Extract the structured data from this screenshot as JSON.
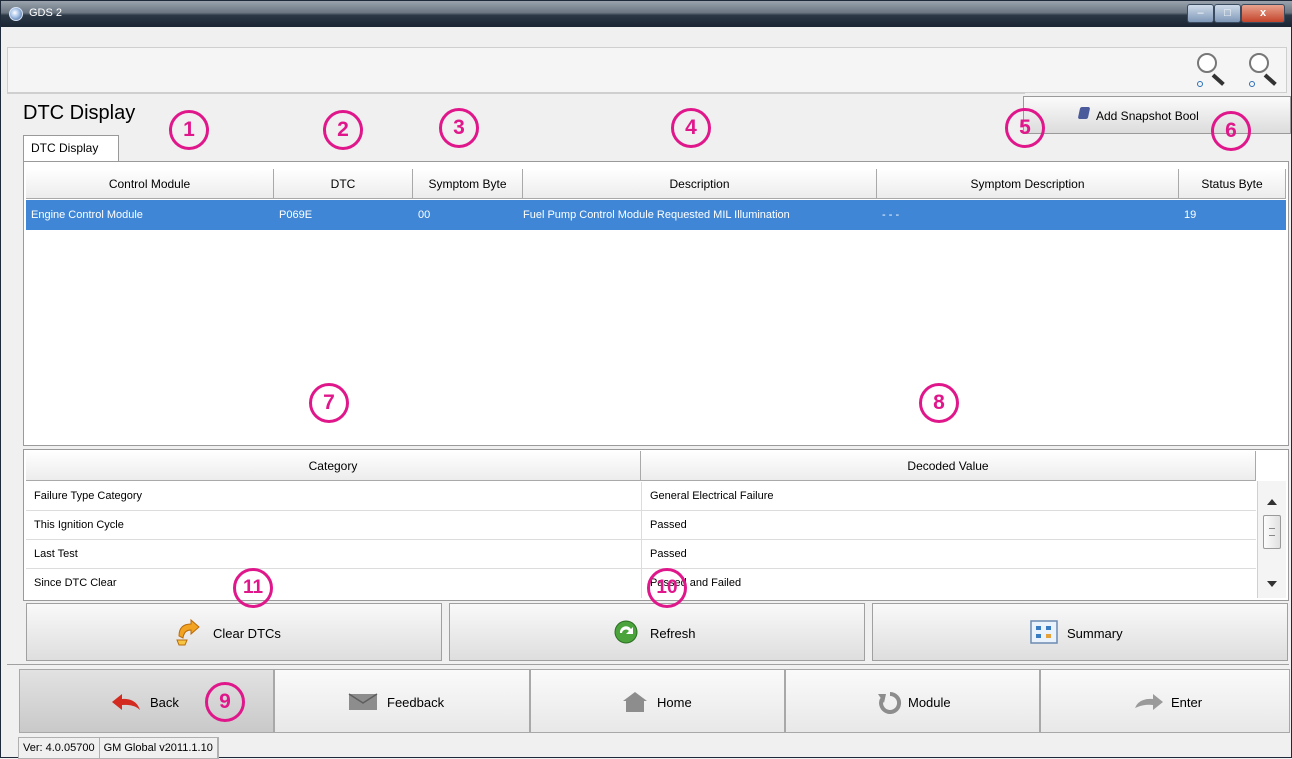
{
  "window": {
    "title": "GDS 2",
    "min_label": "–",
    "max_label": "□",
    "close_label": "x"
  },
  "page": {
    "title": "DTC Display",
    "snapshot_button": "Add Snapshot Bookmark",
    "tab": "DTC Display"
  },
  "dtc_table": {
    "columns": [
      "Control Module",
      "DTC",
      "Symptom Byte",
      "Description",
      "Symptom Description",
      "Status Byte"
    ],
    "rows": [
      {
        "control_module": "Engine Control Module",
        "dtc": "P069E",
        "symptom_byte": "00",
        "description": "Fuel Pump Control Module Requested MIL Illumination",
        "symptom_description": "- - -",
        "status_byte": "19"
      }
    ]
  },
  "detail_table": {
    "columns": [
      "Category",
      "Decoded Value"
    ],
    "rows": [
      {
        "category": "Failure Type Category",
        "value": "General Electrical Failure"
      },
      {
        "category": "This Ignition Cycle",
        "value": "Passed"
      },
      {
        "category": "Last Test",
        "value": "Passed"
      },
      {
        "category": "Since DTC Clear",
        "value": "Passed and Failed"
      }
    ]
  },
  "actions": {
    "clear": "Clear DTCs",
    "refresh": "Refresh",
    "summary": "Summary"
  },
  "nav": {
    "back": "Back",
    "feedback": "Feedback",
    "home": "Home",
    "module": "Module",
    "enter": "Enter"
  },
  "status": {
    "version": "Ver: 4.0.05700",
    "database": "GM Global v2011.1.10"
  },
  "callouts": [
    "1",
    "2",
    "3",
    "4",
    "5",
    "6",
    "7",
    "8",
    "9",
    "10",
    "11"
  ],
  "colors": {
    "selection": "#3f87d6",
    "callout": "#e0178b"
  },
  "icons": [
    "app-icon",
    "zoom-in-icon",
    "zoom-out-icon",
    "bookmark-icon",
    "clear-dtc-icon",
    "refresh-icon",
    "summary-icon",
    "back-arrow-icon",
    "feedback-icon",
    "home-icon",
    "module-icon",
    "enter-arrow-icon"
  ]
}
